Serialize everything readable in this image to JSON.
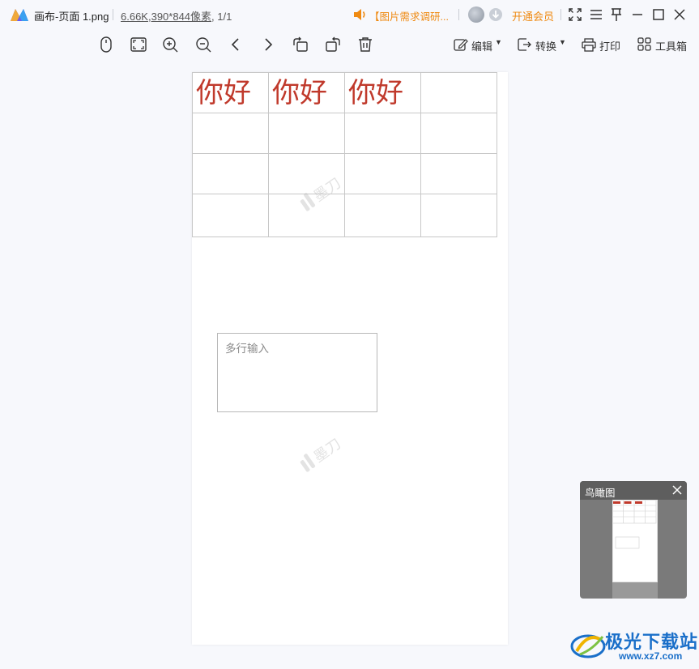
{
  "titlebar": {
    "filename": "画布-页面 1.png",
    "file_size": "6.66K",
    "dimensions": ",390*844像素",
    "page_count": ", 1/1",
    "notice": "【图片需求调研...",
    "vip_label": "开通会员"
  },
  "toolbar": {
    "edit_label": "编辑",
    "convert_label": "转换",
    "print_label": "打印",
    "tools_label": "工具箱"
  },
  "canvas": {
    "table": {
      "rows": [
        [
          "你好",
          "你好",
          "你好",
          ""
        ],
        [
          "",
          "",
          "",
          ""
        ],
        [
          "",
          "",
          "",
          ""
        ],
        [
          "",
          "",
          "",
          ""
        ]
      ]
    },
    "textarea_placeholder": "多行输入",
    "watermark_text": "墨刀"
  },
  "overview": {
    "title": "鸟瞰图"
  },
  "site": {
    "name": "极光下载站",
    "url": "www.xz7.com"
  },
  "colors": {
    "accent_orange": "#ef8a12",
    "cell_text_red": "#c0392b",
    "site_blue": "#1a6fc9"
  }
}
